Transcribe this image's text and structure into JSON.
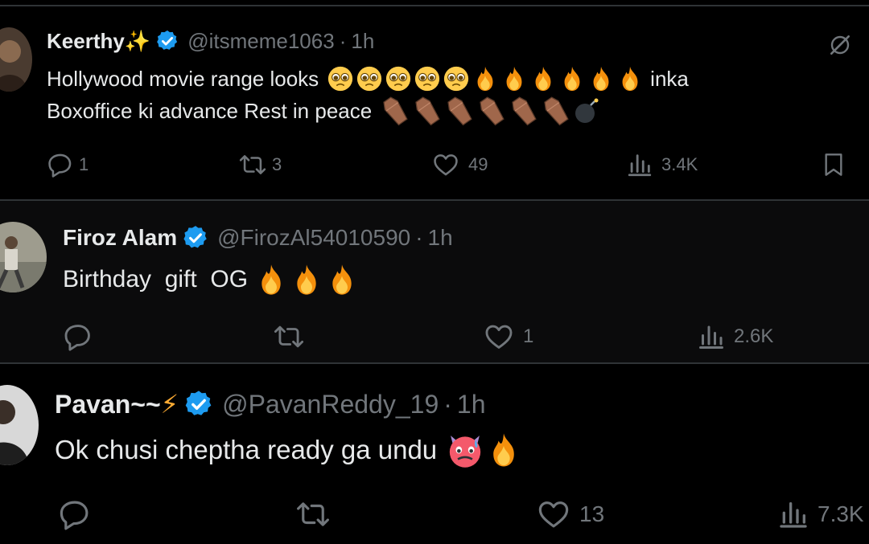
{
  "tweets": [
    {
      "name": "Keerthy",
      "name_suffix": "✨",
      "handle": "@itsmeme1063",
      "time": "1h",
      "text_line1": "Hollywood movie range looks",
      "text_line1_end": "inka",
      "text_line2": "Boxoffice ki advance Rest in peace",
      "replies": "1",
      "retweets": "3",
      "likes": "49",
      "views": "3.4K"
    },
    {
      "name": "Firoz Alam",
      "handle": "@FirozAl54010590",
      "time": "1h",
      "text": "Birthday  gift  OG",
      "replies": "",
      "retweets": "",
      "likes": "1",
      "views": "2.6K"
    },
    {
      "name": "Pavan~~",
      "name_suffix": "⚡",
      "handle": "@PavanReddy_19",
      "time": "1h",
      "text": "Ok chusi cheptha ready ga undu",
      "replies": "",
      "retweets": "",
      "likes": "13",
      "views": "7.3K"
    }
  ],
  "colors": {
    "background": "#000000",
    "text": "#e7e9ea",
    "muted": "#71767b",
    "verified": "#1d9bf0",
    "divider": "#2f3336"
  },
  "icons": [
    "reply-icon",
    "retweet-icon",
    "like-icon",
    "views-icon",
    "bookmark-icon",
    "verified-badge-icon",
    "grok-icon"
  ]
}
